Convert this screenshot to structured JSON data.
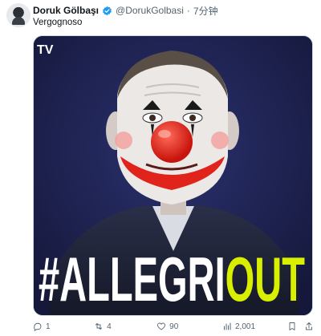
{
  "post": {
    "author_name": "Doruk Gölbaşı",
    "author_handle": "@DorukGolbasi",
    "separator": "·",
    "time": "7分钟",
    "text": "Vergognoso"
  },
  "media": {
    "logo_text": "TV",
    "hashtag_symbol": "#",
    "headline_white": "ALLEGRI",
    "headline_yellow": "OUT",
    "accent_yellow": "#d8f000",
    "background": "#1d2150"
  },
  "actions": {
    "reply_count": "1",
    "repost_count": "4",
    "like_count": "90",
    "views_count": "2,001"
  },
  "colors": {
    "text_secondary": "#536471",
    "verified": "#1d9bf0"
  }
}
